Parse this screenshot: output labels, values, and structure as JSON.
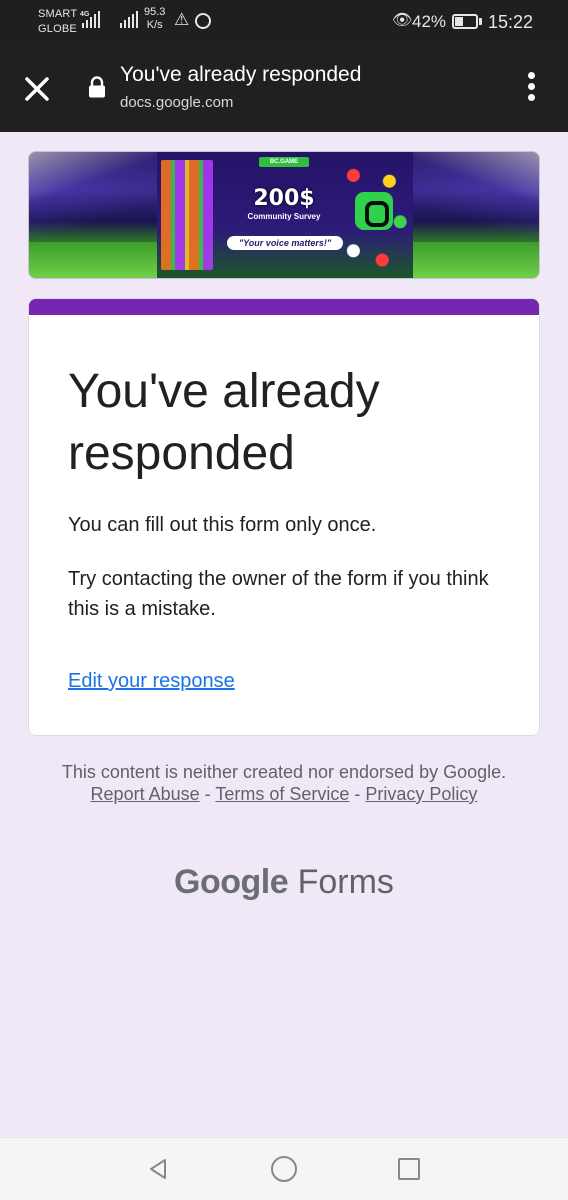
{
  "status_bar": {
    "carrier_line1": "SMART",
    "carrier_line2": "GLOBE",
    "network_type": "4G",
    "network_speed_value": "95.3",
    "network_speed_unit": "K/s",
    "battery_percent": "42%",
    "battery_level": 0.42,
    "time": "15:22",
    "icons": [
      "signal-icon",
      "signal-icon",
      "warning-icon",
      "sync-icon",
      "eye-comfort-icon",
      "battery-icon"
    ]
  },
  "toolbar": {
    "title": "You've already responded",
    "url": "docs.google.com",
    "icons": [
      "close-icon",
      "lock-icon",
      "more-vert-icon"
    ]
  },
  "banner": {
    "brand": "BC.GAME",
    "amount": "200$",
    "subtitle": "Community Survey",
    "tagline": "\"Your voice matters!\""
  },
  "card": {
    "accent_color": "#7527b1",
    "title": "You've already responded",
    "message1": "You can fill out this form only once.",
    "message2": "Try contacting the owner of the form if you think this is a mistake.",
    "link_label": "Edit your response",
    "link_color": "#1a73e8"
  },
  "footer": {
    "disclaimer": "This content is neither created nor endorsed by Google.",
    "report_abuse": "Report Abuse",
    "separator": "-",
    "terms": "Terms of Service",
    "privacy": "Privacy Policy",
    "logo_google": "Google",
    "logo_forms": "Forms"
  },
  "nav_bar": {
    "icons": [
      "back-icon",
      "home-icon",
      "recents-icon"
    ]
  },
  "colors": {
    "page_background": "#f0e8f6",
    "toolbar_background": "#202020"
  }
}
